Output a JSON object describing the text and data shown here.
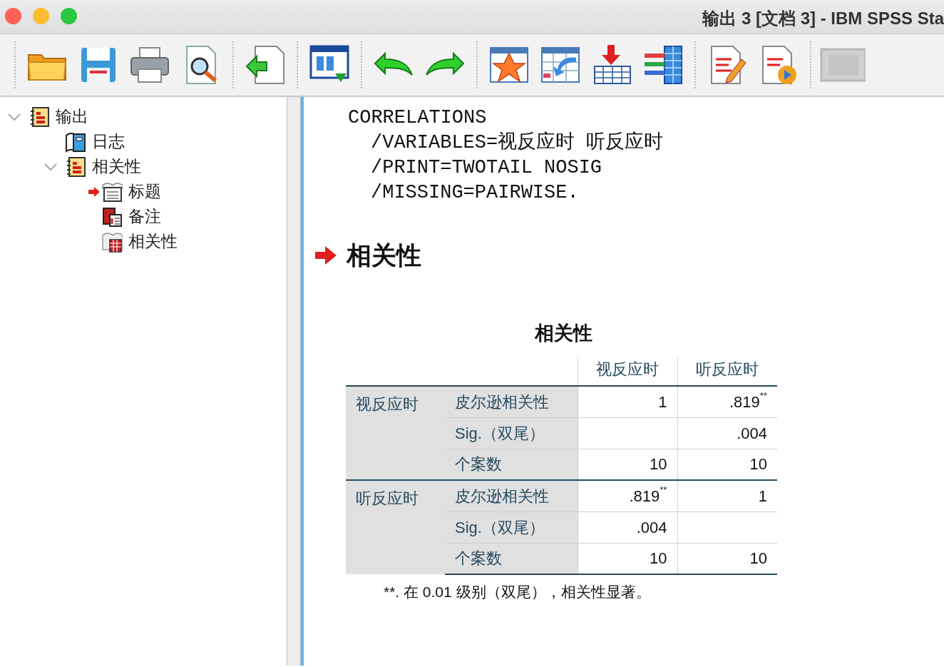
{
  "window": {
    "title": "输出 3 [文档 3] - IBM SPSS Sta"
  },
  "outline": [
    {
      "label": "输出",
      "kind": "output",
      "expanded": true,
      "current": false,
      "children": [
        {
          "label": "日志",
          "kind": "log",
          "current": false
        },
        {
          "label": "相关性",
          "kind": "output",
          "expanded": true,
          "current": false,
          "children": [
            {
              "label": "标题",
              "kind": "title",
              "current": true
            },
            {
              "label": "备注",
              "kind": "notes",
              "current": false
            },
            {
              "label": "相关性",
              "kind": "table",
              "current": false
            }
          ]
        }
      ]
    }
  ],
  "syntax": {
    "lines": [
      "CORRELATIONS",
      "/VARIABLES=视反应时 听反应时",
      "/PRINT=TWOTAIL NOSIG",
      "/MISSING=PAIRWISE."
    ]
  },
  "heading": {
    "text": "相关性",
    "current": true
  },
  "table": {
    "title": "相关性",
    "columns": [
      "视反应时",
      "听反应时"
    ],
    "groups": [
      {
        "label": "视反应时",
        "rows": [
          {
            "stat": "皮尔逊相关性",
            "value_1": "1",
            "value_2": ".819$^{**}$"
          },
          {
            "stat": "Sig.（双尾）",
            "value_2": ".004"
          },
          {
            "stat": "个案数",
            "value_1": "10",
            "value_2": "10"
          }
        ]
      },
      {
        "label": "听反应时",
        "rows": [
          {
            "stat": "皮尔逊相关性",
            "value_1": ".819$^{**}$",
            "value_2": "1"
          },
          {
            "stat": "Sig.（双尾）",
            "value_1": ".004"
          },
          {
            "stat": "个案数",
            "value_1": "10",
            "value_2": "10"
          }
        ]
      }
    ],
    "footnote": "**. 在 0.01 级别（双尾），相关性显著。"
  }
}
